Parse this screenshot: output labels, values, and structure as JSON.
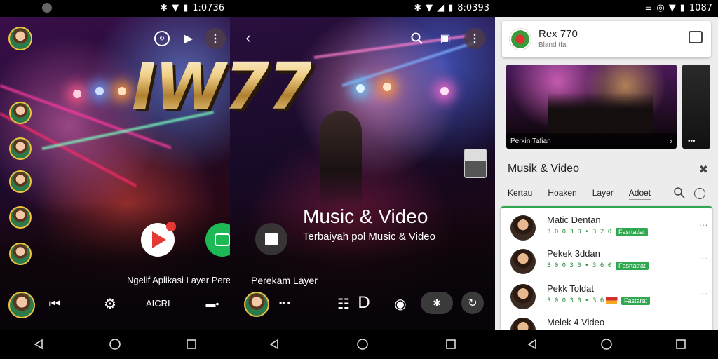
{
  "panel1": {
    "status": {
      "time": "1:0736"
    },
    "caption": "Ngelif Aplikasi Layer Pereken",
    "toolbar_label": "AICRI",
    "colors": {
      "accent": "#f0c040",
      "play_red": "#e53935",
      "play_green": "#1db954",
      "chip_green": "#23a455"
    }
  },
  "logo": {
    "text": "IW77"
  },
  "panel2": {
    "status": {
      "time": "8:0393"
    },
    "title": "Music & Video",
    "subtitle": "Terbaiyah pol Music & Video",
    "caption": "Perekam Layer",
    "time_dots": "•• •"
  },
  "panel3": {
    "status": {
      "time": "1087"
    },
    "header": {
      "title": "Rex 770",
      "subtitle": "Bland tfal"
    },
    "video_caption": "Perkin Tafian",
    "section_title": "Musik & Video",
    "tabs": [
      "Kertau",
      "Hoaken",
      "Layer",
      "Adoet"
    ],
    "rows": [
      {
        "name": "Matic Dentan",
        "meta": "3 0 0 3 0  •  3 2 0 3 3",
        "badge": "Fasrtatlat"
      },
      {
        "name": "Pekek 3ddan",
        "meta": "3 0 0 3 0  •  3 6 0 3 0",
        "badge": "Fasrtatrat"
      },
      {
        "name": "Pekk Toldat",
        "meta": "3 0 0 3 0  •  3 6 0 3 0",
        "badge": "Fastarat"
      },
      {
        "name": "Melek 4 Video",
        "meta": "",
        "badge": ""
      }
    ]
  }
}
